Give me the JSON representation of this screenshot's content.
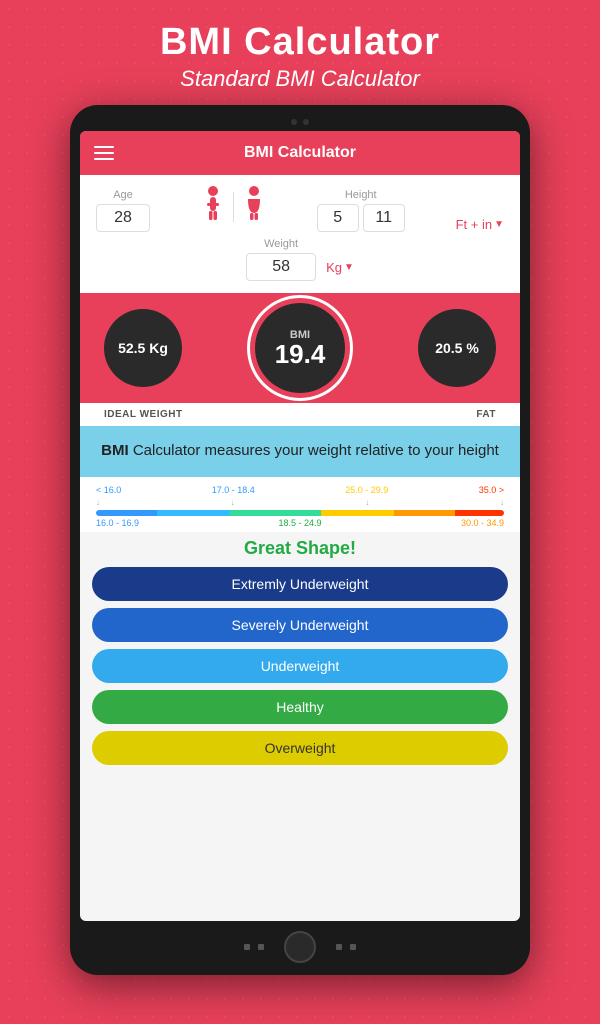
{
  "header": {
    "main_title": "BMI Calculator",
    "subtitle": "Standard BMI Calculator"
  },
  "topbar": {
    "title": "BMI Calculator",
    "menu_icon": "≡"
  },
  "inputs": {
    "age_label": "Age",
    "age_value": "28",
    "height_label": "Height",
    "height_ft": "5",
    "height_in": "11",
    "height_unit": "Ft + in",
    "weight_label": "Weight",
    "weight_value": "58",
    "weight_unit": "Kg"
  },
  "bmi_result": {
    "bmi_label": "BMI",
    "bmi_value": "19.4",
    "ideal_weight_value": "52.5 Kg",
    "ideal_weight_label": "IDEAL WEIGHT",
    "fat_value": "20.5 %",
    "fat_label": "FAT"
  },
  "info_banner": {
    "bold_text": "BMI",
    "rest_text": " Calculator measures your weight relative to your height"
  },
  "scale": {
    "ranges": [
      {
        "value": "< 16.0",
        "color": "low"
      },
      {
        "value": "17.0 - 18.4",
        "color": "low"
      },
      {
        "value": "25.0 - 29.9",
        "color": "mid"
      },
      {
        "value": "35.0 >",
        "color": "high"
      }
    ],
    "sub_ranges": [
      {
        "value": "16.0 - 16.9",
        "color": "low"
      },
      {
        "value": "18.5 - 24.9",
        "color": "green"
      },
      {
        "value": "30.0 - 34.9",
        "color": "high-mid"
      }
    ],
    "status": "Great Shape!"
  },
  "categories": [
    {
      "label": "Extremly Underweight",
      "style": "dark-blue"
    },
    {
      "label": "Severely Underweight",
      "style": "blue"
    },
    {
      "label": "Underweight",
      "style": "light-blue"
    },
    {
      "label": "Healthy",
      "style": "green"
    },
    {
      "label": "Overweight",
      "style": "yellow"
    }
  ]
}
